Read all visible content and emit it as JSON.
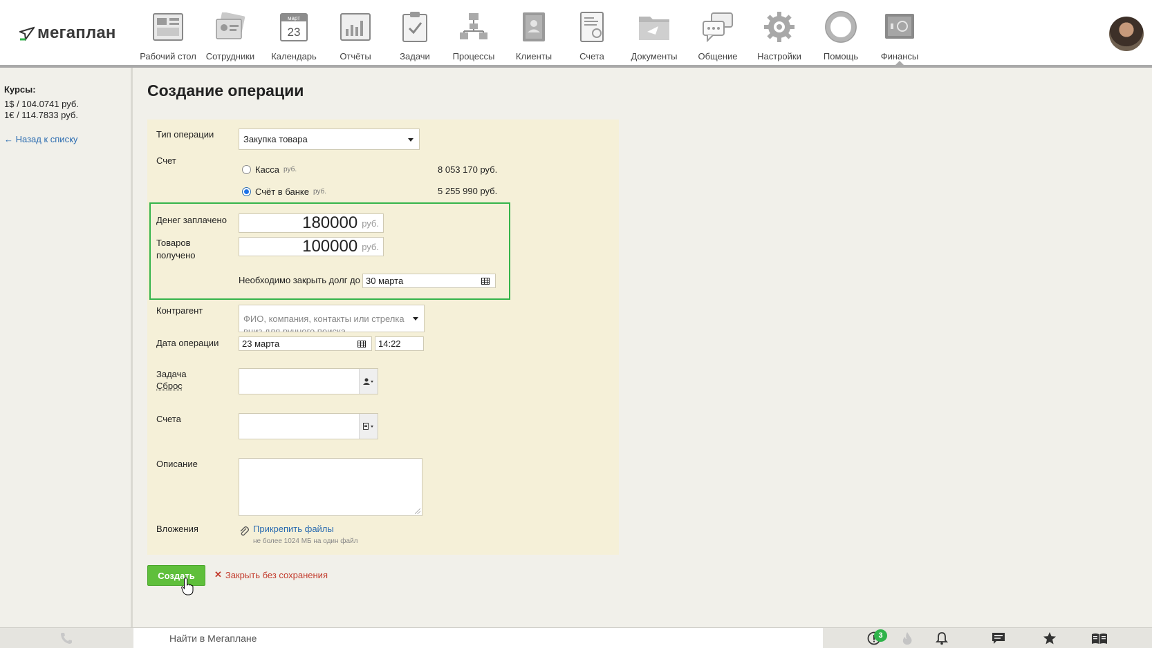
{
  "header": {
    "logo_text": "мегаплан",
    "nav": [
      {
        "label": "Рабочий стол",
        "icon": "desktop-icon"
      },
      {
        "label": "Сотрудники",
        "icon": "employees-icon"
      },
      {
        "label": "Календарь",
        "icon": "calendar-icon",
        "month": "март",
        "day": "23"
      },
      {
        "label": "Отчёты",
        "icon": "reports-icon"
      },
      {
        "label": "Задачи",
        "icon": "tasks-icon"
      },
      {
        "label": "Процессы",
        "icon": "processes-icon"
      },
      {
        "label": "Клиенты",
        "icon": "clients-icon"
      },
      {
        "label": "Счета",
        "icon": "invoices-icon"
      },
      {
        "label": "Документы",
        "icon": "documents-icon"
      },
      {
        "label": "Общение",
        "icon": "chat-icon"
      },
      {
        "label": "Настройки",
        "icon": "settings-icon"
      },
      {
        "label": "Помощь",
        "icon": "help-icon"
      },
      {
        "label": "Финансы",
        "icon": "finance-icon",
        "active": true
      }
    ]
  },
  "sidebar": {
    "rates_title": "Курсы:",
    "rates": [
      "1$ / 104.0741 руб.",
      "1€ / 114.7833 руб."
    ],
    "back_link": "←  Назад к списку"
  },
  "page": {
    "title": "Создание операции"
  },
  "form": {
    "operation_type_label": "Тип операции",
    "operation_type_value": "Закупка товара",
    "account_label": "Счет",
    "accounts": [
      {
        "name": "Касса",
        "currency": "руб.",
        "balance": "8 053 170 руб.",
        "selected": false
      },
      {
        "name": "Счёт в банке",
        "currency": "руб.",
        "balance": "5 255 990 руб.",
        "selected": true
      }
    ],
    "money_paid_label": "Денег заплачено",
    "money_paid_value": "180000",
    "goods_received_label_1": "Товаров",
    "goods_received_label_2": "получено",
    "goods_received_value": "100000",
    "currency": "руб.",
    "debt_label": "Необходимо закрыть долг до",
    "debt_date": "30 марта",
    "counterparty_label": "Контрагент",
    "counterparty_placeholder_1": "ФИО, компания, контакты или стрелка",
    "counterparty_placeholder_2": "вниз для ручного поиска",
    "operation_date_label": "Дата операции",
    "operation_date": "23 марта",
    "operation_time": "14:22",
    "task_label": "Задача",
    "reset_label": "Сброс",
    "invoices_label": "Счета",
    "description_label": "Описание",
    "attachments_label": "Вложения",
    "attach_link": "Прикрепить файлы",
    "attach_hint": "не более 1024 МБ на один файл"
  },
  "actions": {
    "create": "Создать",
    "close": "Закрыть без сохранения"
  },
  "footer": {
    "search_placeholder": "Найти в Мегаплане",
    "alerts_count": "3"
  },
  "colors": {
    "accent_green": "#5fbf3b",
    "highlight_border": "#34b44a",
    "form_bg": "#f5f0d8",
    "link_blue": "#2a6bb0",
    "danger_red": "#c23a2c"
  }
}
